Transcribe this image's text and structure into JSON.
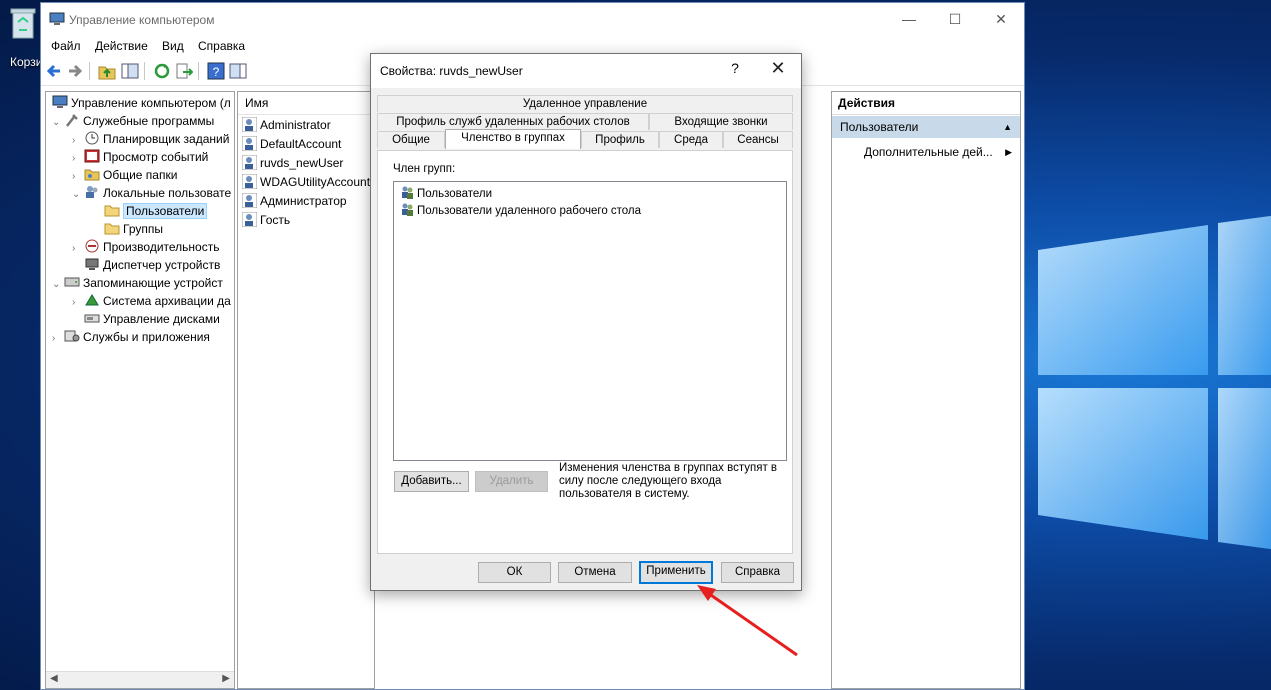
{
  "desktop": {
    "recycle_bin_label": "Корзи"
  },
  "window": {
    "title": "Управление компьютером",
    "minimize_icon": "minimize-icon",
    "maximize_icon": "maximize-icon",
    "close_icon": "close-icon"
  },
  "menu": {
    "items": [
      "Файл",
      "Действие",
      "Вид",
      "Справка"
    ]
  },
  "tree": {
    "items": [
      "Управление компьютером (л",
      "Служебные программы",
      "Планировщик заданий",
      "Просмотр событий",
      "Общие папки",
      "Локальные пользовате",
      "Пользователи",
      "Группы",
      "Производительность",
      "Диспетчер устройств",
      "Запоминающие устройст",
      "Система архивации да",
      "Управление дисками",
      "Службы и приложения"
    ]
  },
  "list": {
    "header": "Имя",
    "users": [
      "Administrator",
      "DefaultAccount",
      "ruvds_newUser",
      "WDAGUtilityAccount",
      "Администратор",
      "Гость"
    ]
  },
  "actions": {
    "header": "Действия",
    "section": "Пользователи",
    "more": "Дополнительные дей..."
  },
  "dialog": {
    "title": "Свойства: ruvds_newUser",
    "help": "?",
    "close": "✕",
    "tabs_row1": [
      "Удаленное управление"
    ],
    "tabs_row2": [
      "Профиль служб удаленных рабочих столов",
      "Входящие звонки"
    ],
    "tabs_row3": [
      "Общие",
      "Членство в группах",
      "Профиль",
      "Среда",
      "Сеансы"
    ],
    "member_label": "Член групп:",
    "groups": [
      "Пользователи",
      "Пользователи удаленного рабочего стола"
    ],
    "add_button": "Добавить...",
    "remove_button": "Удалить",
    "note": "Изменения членства в группах вступят в силу после следующего входа пользователя в систему.",
    "ok_button": "ОК",
    "cancel_button": "Отмена",
    "apply_button": "Применить",
    "help_button": "Справка"
  }
}
